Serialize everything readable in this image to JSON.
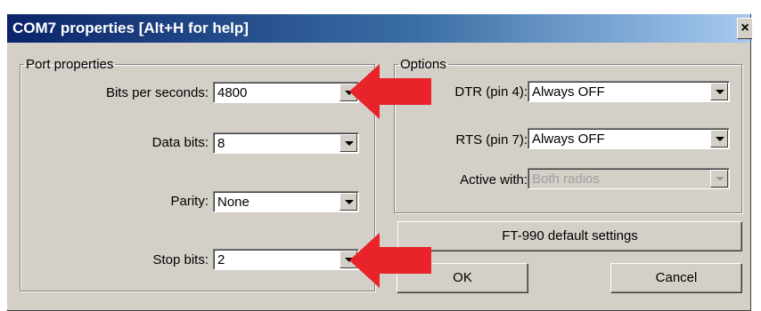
{
  "window": {
    "title": "COM7 properties [Alt+H for help]",
    "close_symbol": "×"
  },
  "port": {
    "legend": "Port properties",
    "fields": [
      {
        "label": "Bits per seconds:",
        "value": "4800"
      },
      {
        "label": "Data bits:",
        "value": "8"
      },
      {
        "label": "Parity:",
        "value": "None"
      },
      {
        "label": "Stop bits:",
        "value": "2"
      }
    ]
  },
  "options": {
    "legend": "Options",
    "fields": [
      {
        "label": "DTR (pin 4):",
        "value": "Always OFF"
      },
      {
        "label": "RTS (pin 7):",
        "value": "Always OFF"
      },
      {
        "label": "Active with:",
        "value": "Both radios",
        "disabled": true
      }
    ]
  },
  "buttons": {
    "defaults": "FT-990 default settings",
    "ok": "OK",
    "cancel": "Cancel"
  },
  "annotations": {
    "arrow_color": "#e8232a",
    "arrows": [
      "red-arrow-pointing-left",
      "red-arrow-pointing-left"
    ]
  }
}
